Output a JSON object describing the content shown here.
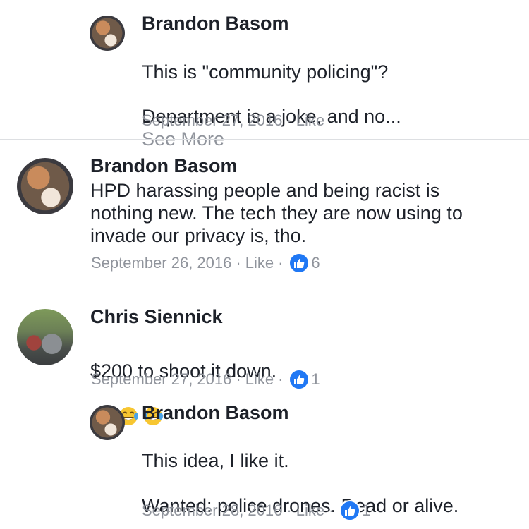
{
  "comments": [
    {
      "author": "Brandon Basom",
      "line1": "This is \"community policing\"?",
      "line2": "Department is a joke, and no...",
      "see_more": "See More",
      "date": "September 27, 2016",
      "like_label": "Like",
      "reply": true
    },
    {
      "author": "Brandon Basom",
      "text": "HPD harassing people and being racist is\nnothing new. The tech they are now using to\ninvade our privacy is, tho.",
      "date": "September 26, 2016",
      "like_label": "Like",
      "like_count": "6",
      "reply": false
    },
    {
      "author": "Chris Siennick",
      "text": "$200 to shoot it down.",
      "emoji": [
        "tears-of-joy-emoji",
        "tears-of-joy-emoji",
        "tears-of-joy-emoji"
      ],
      "date": "September 27, 2016",
      "like_label": "Like",
      "like_count": "1",
      "reply": false
    },
    {
      "author": "Brandon Basom",
      "line1": "This idea, I like it.",
      "line2": "Wanted: police drones. Dead or alive.",
      "date": "September 28, 2016",
      "like_label": "Like",
      "like_count": "1",
      "reply": true
    }
  ],
  "separator": "·",
  "icons": {
    "like_badge": "thumbs-up-icon",
    "emoji": "tears-of-joy-emoji"
  },
  "colors": {
    "accent": "#2078f4",
    "text": "#1d2129",
    "muted": "#90949c",
    "divider": "#dddfe2"
  }
}
